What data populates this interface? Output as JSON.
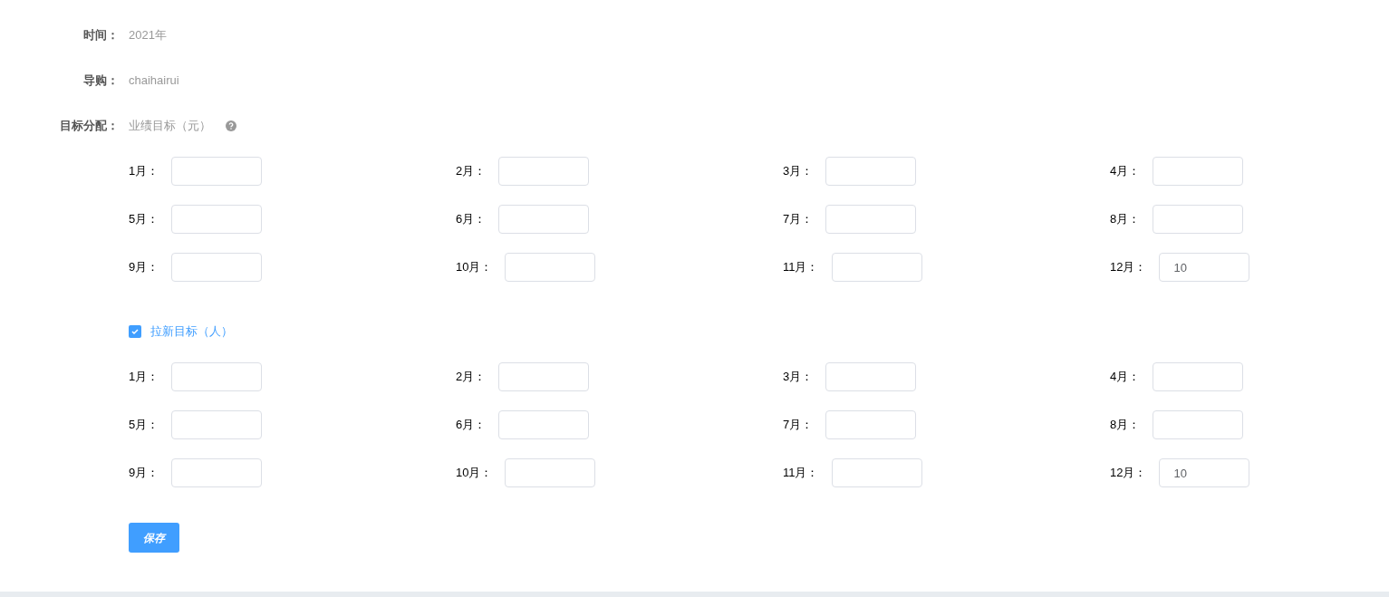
{
  "info": [
    {
      "label": "时间：",
      "value": "2021年"
    },
    {
      "label": "导购：",
      "value": "chaihairui"
    }
  ],
  "allocation": {
    "label": "目标分配：",
    "sections": [
      {
        "kind": "plain",
        "title": "业绩目标（元）",
        "months": [
          {
            "label": "1月："
          },
          {
            "label": "2月："
          },
          {
            "label": "3月："
          },
          {
            "label": "4月："
          },
          {
            "label": "5月："
          },
          {
            "label": "6月："
          },
          {
            "label": "7月："
          },
          {
            "label": "8月："
          },
          {
            "label": "9月："
          },
          {
            "label": "10月："
          },
          {
            "label": "11月："
          },
          {
            "label": "12月：",
            "value": "10"
          }
        ]
      },
      {
        "kind": "checkbox",
        "title": "拉新目标（人）",
        "checked": true,
        "months": [
          {
            "label": "1月："
          },
          {
            "label": "2月："
          },
          {
            "label": "3月："
          },
          {
            "label": "4月："
          },
          {
            "label": "5月："
          },
          {
            "label": "6月："
          },
          {
            "label": "7月："
          },
          {
            "label": "8月："
          },
          {
            "label": "9月："
          },
          {
            "label": "10月："
          },
          {
            "label": "11月："
          },
          {
            "label": "12月：",
            "value": "10"
          }
        ]
      }
    ]
  },
  "save_button": "保存"
}
